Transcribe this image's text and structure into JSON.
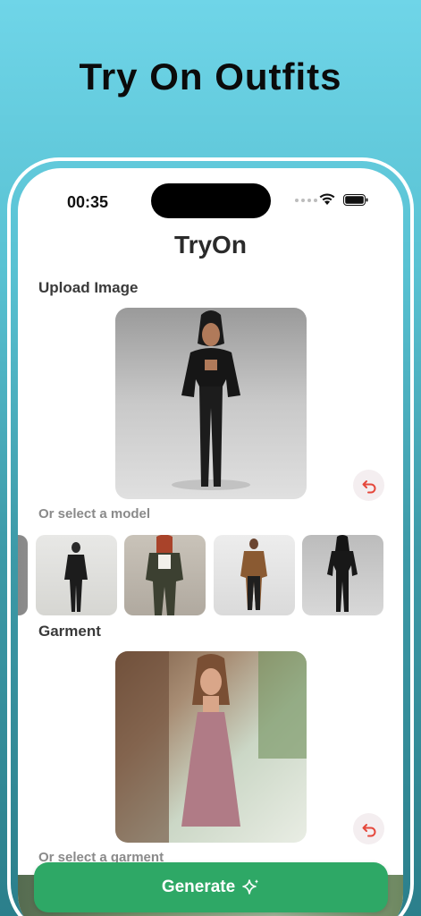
{
  "headline": "Try On Outfits",
  "status": {
    "time": "00:35"
  },
  "app": {
    "title": "TryOn"
  },
  "upload": {
    "label": "Upload Image"
  },
  "models": {
    "label": "Or select a model"
  },
  "garment": {
    "label": "Garment",
    "select_label": "Or select a garment"
  },
  "generate": {
    "label": "Generate"
  },
  "colors": {
    "accent": "#2ea866",
    "undo_icon": "#e5483c"
  }
}
